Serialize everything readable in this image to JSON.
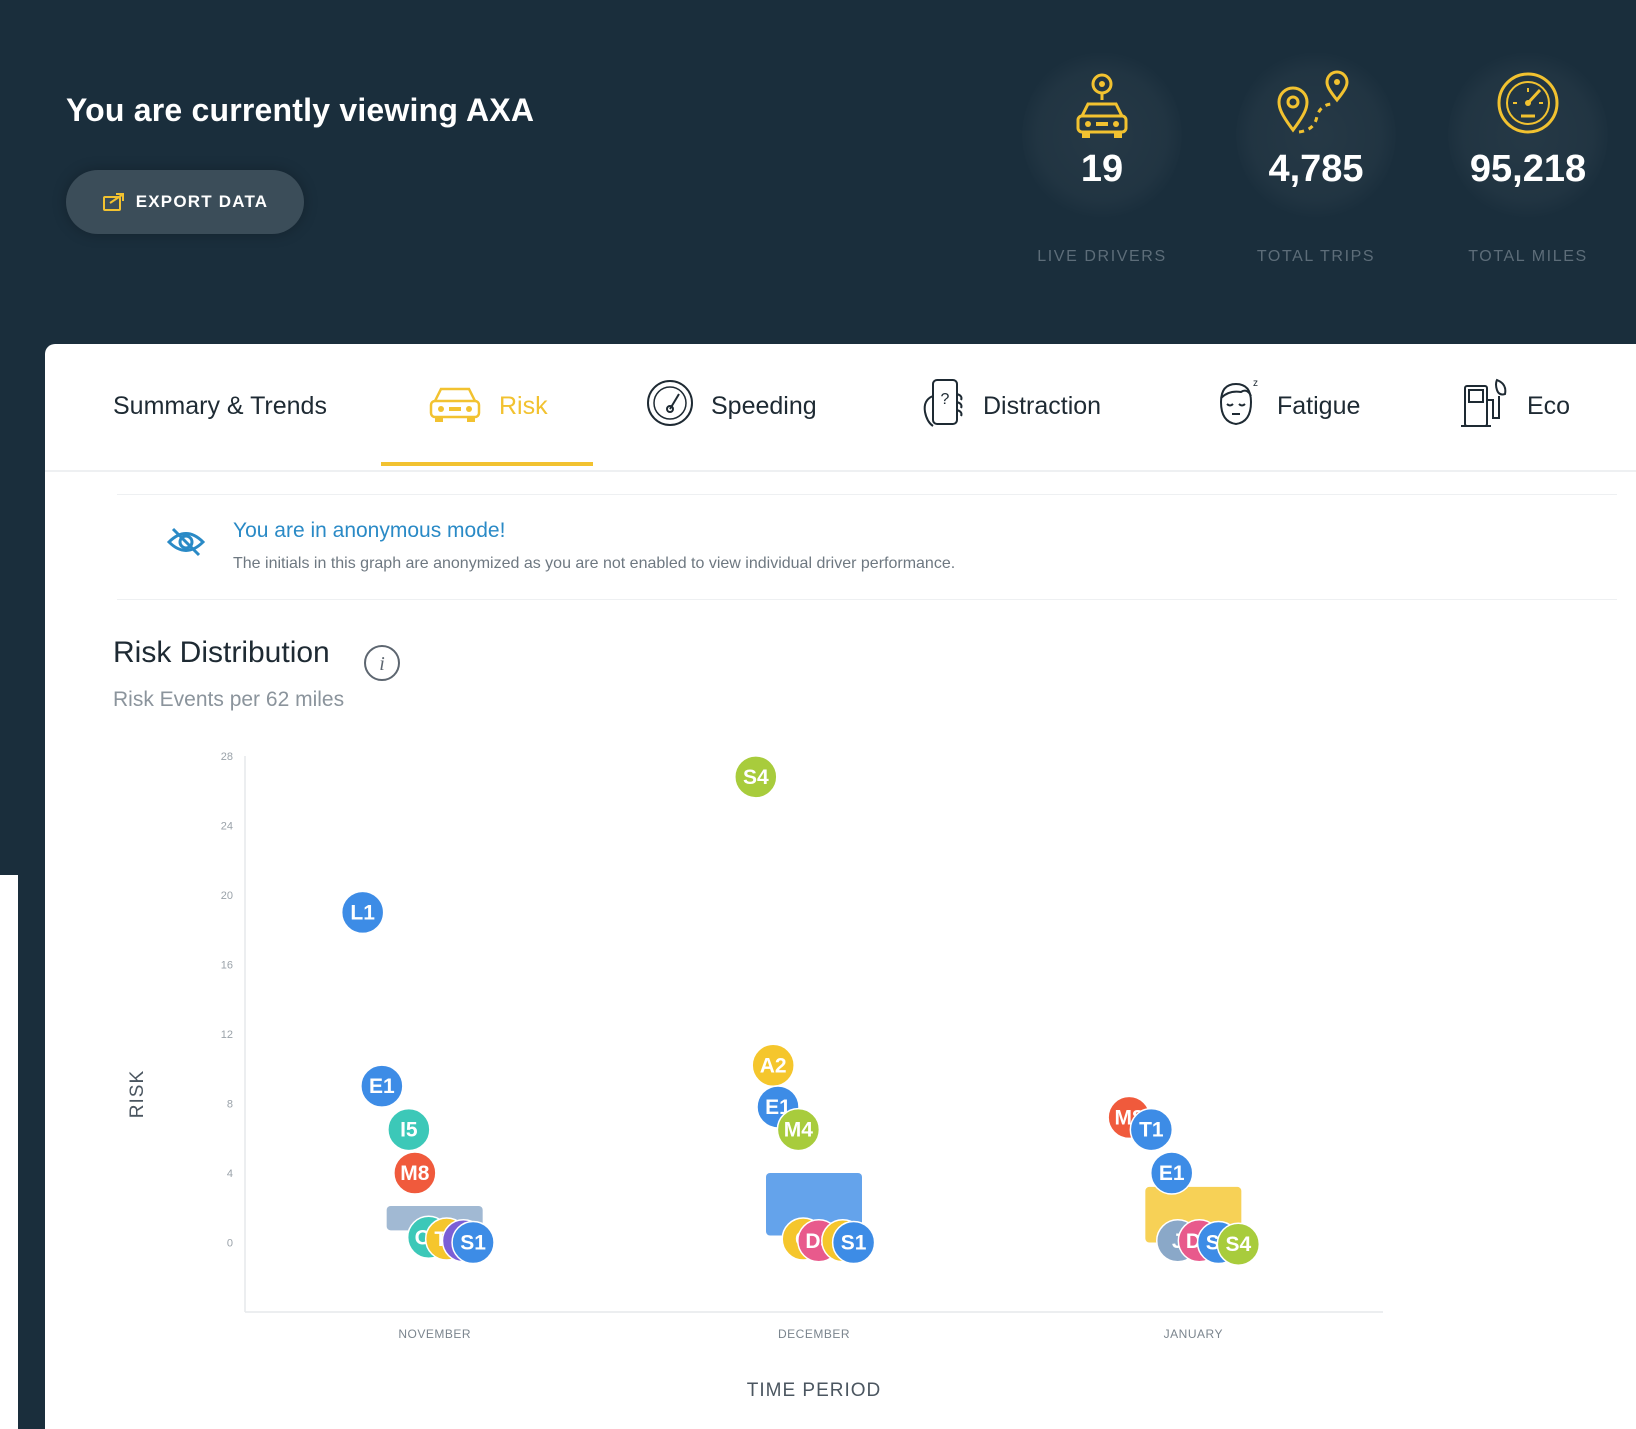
{
  "header": {
    "title": "You are currently viewing AXA",
    "export_label": "EXPORT DATA"
  },
  "stats": [
    {
      "value": "19",
      "label": "LIVE DRIVERS",
      "icon": "car-pin-icon"
    },
    {
      "value": "4,785",
      "label": "TOTAL TRIPS",
      "icon": "route-icon"
    },
    {
      "value": "95,218",
      "label": "TOTAL MILES",
      "icon": "speedometer-icon"
    }
  ],
  "tabs": [
    {
      "label": "Summary & Trends",
      "icon": null,
      "active": false
    },
    {
      "label": "Risk",
      "icon": "car-icon",
      "active": true
    },
    {
      "label": "Speeding",
      "icon": "speedometer-icon",
      "active": false
    },
    {
      "label": "Distraction",
      "icon": "phone-hand-icon",
      "active": false
    },
    {
      "label": "Fatigue",
      "icon": "tired-face-icon",
      "active": false
    },
    {
      "label": "Eco",
      "icon": "fuel-pump-icon",
      "active": false
    }
  ],
  "notice": {
    "title": "You are in anonymous mode!",
    "text": "The initials in this graph are anonymized as you are not enabled to view individual driver performance."
  },
  "section": {
    "title": "Risk Distribution",
    "subtitle": "Risk Events per 62 miles"
  },
  "colors": {
    "background": "#1a2e3c",
    "accent": "#f2c230",
    "link": "#2a8ac6",
    "blue": "#3d8ce6",
    "green": "#a8cc3c",
    "teal": "#3cc8b8",
    "orange": "#f05a3c",
    "yellow": "#f5c62c",
    "pink": "#e85a8c",
    "purple": "#7b5fd6",
    "slate": "#8aa8c8"
  },
  "chart_data": {
    "type": "scatter",
    "xlabel": "TIME PERIOD",
    "ylabel": "RISK",
    "categories": [
      "NOVEMBER",
      "DECEMBER",
      "JANUARY"
    ],
    "yticks": [
      0,
      4,
      8,
      12,
      16,
      20,
      24,
      28
    ],
    "ylim": [
      -4,
      28
    ],
    "boxes": [
      {
        "category": "NOVEMBER",
        "low": 0.7,
        "high": 2.1,
        "color": "#8aa8c8"
      },
      {
        "category": "DECEMBER",
        "low": 0.4,
        "high": 4.0,
        "color": "#3d8ce6"
      },
      {
        "category": "JANUARY",
        "low": 0.0,
        "high": 3.2,
        "color": "#f5c62c"
      }
    ],
    "points": [
      {
        "category": "NOVEMBER",
        "offset": -1.2,
        "y": 19.0,
        "label": "L1",
        "color": "#3d8ce6"
      },
      {
        "category": "NOVEMBER",
        "offset": -0.88,
        "y": 9.0,
        "label": "E1",
        "color": "#3d8ce6"
      },
      {
        "category": "NOVEMBER",
        "offset": -0.43,
        "y": 6.5,
        "label": "I5",
        "color": "#3cc8b8"
      },
      {
        "category": "NOVEMBER",
        "offset": -0.33,
        "y": 4.0,
        "label": "M8",
        "color": "#f05a3c"
      },
      {
        "category": "NOVEMBER",
        "offset": -0.1,
        "y": 0.3,
        "label": "O5",
        "color": "#3cc8b8"
      },
      {
        "category": "NOVEMBER",
        "offset": 0.2,
        "y": 0.2,
        "label": "T2",
        "color": "#f5c62c"
      },
      {
        "category": "NOVEMBER",
        "offset": 0.48,
        "y": 0.1,
        "label": "J",
        "color": "#7b5fd6"
      },
      {
        "category": "NOVEMBER",
        "offset": 0.64,
        "y": 0.0,
        "label": "S1",
        "color": "#3d8ce6"
      },
      {
        "category": "DECEMBER",
        "offset": -0.97,
        "y": 26.8,
        "label": "S4",
        "color": "#a8cc3c"
      },
      {
        "category": "DECEMBER",
        "offset": -0.68,
        "y": 10.2,
        "label": "A2",
        "color": "#f5c62c"
      },
      {
        "category": "DECEMBER",
        "offset": -0.6,
        "y": 7.8,
        "label": "E1",
        "color": "#3d8ce6"
      },
      {
        "category": "DECEMBER",
        "offset": -0.26,
        "y": 6.5,
        "label": "M4",
        "color": "#a8cc3c"
      },
      {
        "category": "DECEMBER",
        "offset": -0.18,
        "y": 0.2,
        "label": "G",
        "color": "#f5c62c"
      },
      {
        "category": "DECEMBER",
        "offset": 0.08,
        "y": 0.1,
        "label": "D3",
        "color": "#e85a8c"
      },
      {
        "category": "DECEMBER",
        "offset": 0.48,
        "y": 0.1,
        "label": "V",
        "color": "#f5c62c"
      },
      {
        "category": "DECEMBER",
        "offset": 0.66,
        "y": 0.0,
        "label": "S1",
        "color": "#3d8ce6"
      },
      {
        "category": "JANUARY",
        "offset": -1.07,
        "y": 7.2,
        "label": "M8",
        "color": "#f05a3c"
      },
      {
        "category": "JANUARY",
        "offset": -0.7,
        "y": 6.5,
        "label": "T1",
        "color": "#3d8ce6"
      },
      {
        "category": "JANUARY",
        "offset": -0.36,
        "y": 4.0,
        "label": "E1",
        "color": "#3d8ce6"
      },
      {
        "category": "JANUARY",
        "offset": -0.26,
        "y": 0.1,
        "label": "J",
        "color": "#8aa8c8"
      },
      {
        "category": "JANUARY",
        "offset": 0.1,
        "y": 0.1,
        "label": "D3",
        "color": "#e85a8c"
      },
      {
        "category": "JANUARY",
        "offset": 0.42,
        "y": 0.0,
        "label": "S1",
        "color": "#3d8ce6"
      },
      {
        "category": "JANUARY",
        "offset": 0.75,
        "y": -0.1,
        "label": "S4",
        "color": "#a8cc3c"
      }
    ]
  }
}
